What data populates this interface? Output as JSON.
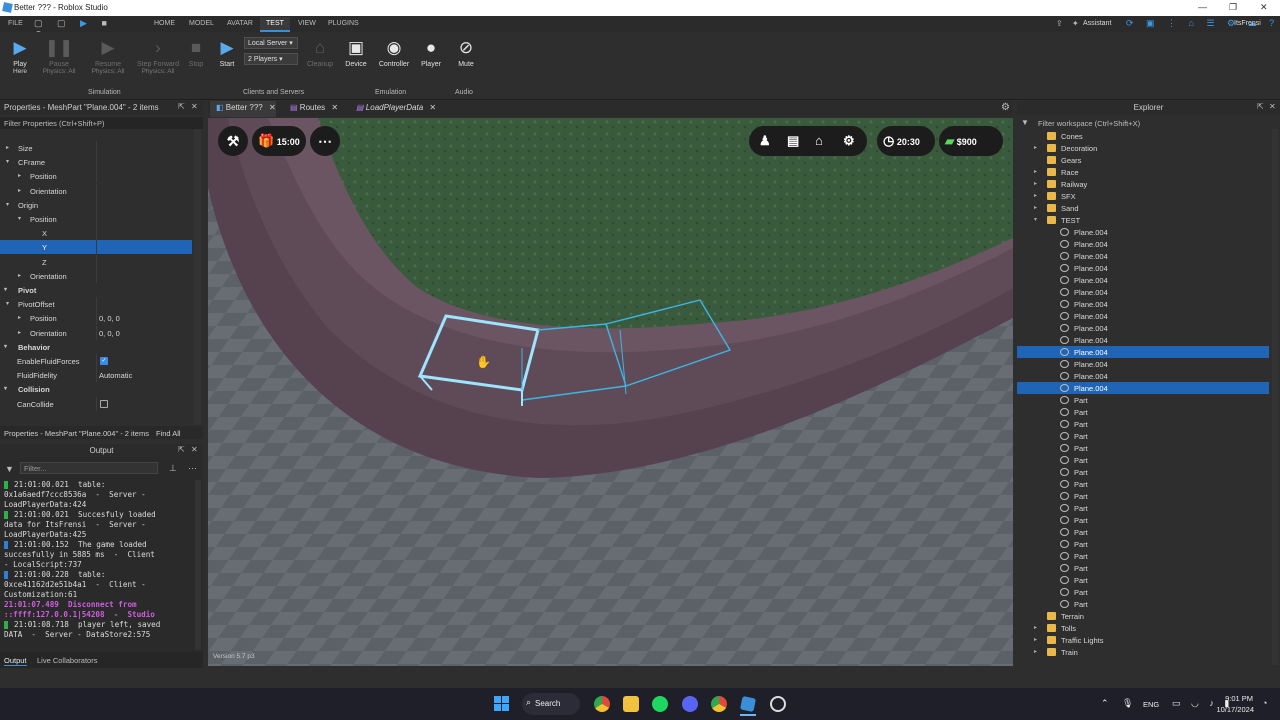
{
  "window": {
    "title": "Better ??? - Roblox Studio"
  },
  "menu": {
    "file": "FILE",
    "tabs": [
      "HOME",
      "MODEL",
      "AVATAR",
      "TEST",
      "VIEW",
      "PLUGINS"
    ],
    "assistant": "Assistant",
    "user": "ItsFrensi"
  },
  "ribbon": {
    "play": "Play",
    "play_sub": "Here",
    "pause": "Pause",
    "pause_sub": "Physics: All",
    "resume": "Resume",
    "resume_sub": "Physics: All",
    "step": "Step Forward",
    "step_sub": "Physics: All",
    "stop": "Stop",
    "start": "Start",
    "server_dd": "Local Server",
    "players_dd": "2 Players",
    "cleanup": "Cleanup",
    "device": "Device",
    "controller": "Controller",
    "player": "Player",
    "mute": "Mute",
    "groups": {
      "simulation": "Simulation",
      "clients": "Clients and Servers",
      "emulation": "Emulation",
      "audio": "Audio"
    }
  },
  "properties": {
    "title": "Properties - MeshPart \"Plane.004\" - 2 items",
    "filter": "Filter Properties (Ctrl+Shift+P)",
    "rows": [
      {
        "name": "Size",
        "indent": 1,
        "arrow": "▸"
      },
      {
        "name": "CFrame",
        "indent": 1,
        "arrow": "▾"
      },
      {
        "name": "Position",
        "indent": 2,
        "arrow": "▸"
      },
      {
        "name": "Orientation",
        "indent": 2,
        "arrow": "▸"
      },
      {
        "name": "Origin",
        "indent": 1,
        "arrow": "▾"
      },
      {
        "name": "Position",
        "indent": 2,
        "arrow": "▾"
      },
      {
        "name": "X",
        "indent": 3
      },
      {
        "name": "Y",
        "indent": 3,
        "sel": true
      },
      {
        "name": "Z",
        "indent": 3
      },
      {
        "name": "Orientation",
        "indent": 2,
        "arrow": "▸"
      },
      {
        "name": "Pivot",
        "indent": 0,
        "arrow": "▾",
        "cat": true
      },
      {
        "name": "PivotOffset",
        "indent": 1,
        "arrow": "▾"
      },
      {
        "name": "Position",
        "indent": 2,
        "arrow": "▸",
        "value": "0, 0, 0"
      },
      {
        "name": "Orientation",
        "indent": 2,
        "arrow": "▸",
        "value": "0, 0, 0"
      },
      {
        "name": "Behavior",
        "indent": 0,
        "arrow": "▾",
        "cat": true
      },
      {
        "name": "EnableFluidForces",
        "indent": 1,
        "check": "on"
      },
      {
        "name": "FluidFidelity",
        "indent": 1,
        "value": "Automatic"
      },
      {
        "name": "Collision",
        "indent": 0,
        "arrow": "▾",
        "cat": true
      },
      {
        "name": "CanCollide",
        "indent": 1,
        "check": "off"
      }
    ],
    "footer": "Properties - MeshPart \"Plane.004\" - 2 items",
    "find_all": "Find All"
  },
  "output": {
    "title": "Output",
    "filter_placeholder": "Filter...",
    "lines": [
      {
        "text": "21:01:00.021  table:",
        "mark": "#2fae4a"
      },
      {
        "text": "0x1a6aedf7ccc8536a  -  Server -"
      },
      {
        "text": "LoadPlayerData:424"
      },
      {
        "text": "21:01:00.021  Succesfuly loaded",
        "mark": "#2fae4a"
      },
      {
        "text": "data for ItsFrensi  -  Server -"
      },
      {
        "text": "LoadPlayerData:425"
      },
      {
        "text": "21:01:00.152  The game loaded",
        "mark": "#2f7fd6"
      },
      {
        "text": "succesfully in 5885 ms  -  Client"
      },
      {
        "text": "- LocalScript:737"
      },
      {
        "text": "21:01:00.228  table:",
        "mark": "#2f7fd6"
      },
      {
        "text": "0xce41162d2e51b4a1  -  Client -"
      },
      {
        "text": "Customization:61"
      },
      {
        "text": "21:01:07.489  Disconnect from",
        "style": "dis"
      },
      {
        "text": "::ffff:127.0.0.1|54208  -  Studio",
        "style": "dis"
      },
      {
        "text": "21:01:08.718  player left, saved",
        "mark": "#2fae4a"
      },
      {
        "text": "DATA  -  Server - DataStore2:575"
      }
    ],
    "tabs": [
      "Output",
      "Live Collaborators"
    ]
  },
  "doc_tabs": [
    "Better ???",
    "Routes",
    "LoadPlayerData"
  ],
  "hud": {
    "timer1": "15:00",
    "timer2": "20:30",
    "money": "$900",
    "version": "Version 5.7 p3"
  },
  "explorer": {
    "title": "Explorer",
    "filter": "Filter workspace (Ctrl+Shift+X)",
    "items": [
      {
        "n": "Cones",
        "t": "folder",
        "i": 1
      },
      {
        "n": "Decoration",
        "t": "folder",
        "i": 1,
        "a": "▸"
      },
      {
        "n": "Gears",
        "t": "folder",
        "i": 1
      },
      {
        "n": "Race",
        "t": "folder",
        "i": 1,
        "a": "▸"
      },
      {
        "n": "Railway",
        "t": "folder",
        "i": 1,
        "a": "▸"
      },
      {
        "n": "SFX",
        "t": "folder",
        "i": 1,
        "a": "▸"
      },
      {
        "n": "Sand",
        "t": "folder",
        "i": 1,
        "a": "▸"
      },
      {
        "n": "TEST",
        "t": "folder",
        "i": 1,
        "a": "▾"
      },
      {
        "n": "Plane.004",
        "t": "mesh",
        "i": 2
      },
      {
        "n": "Plane.004",
        "t": "mesh",
        "i": 2
      },
      {
        "n": "Plane.004",
        "t": "mesh",
        "i": 2
      },
      {
        "n": "Plane.004",
        "t": "mesh",
        "i": 2
      },
      {
        "n": "Plane.004",
        "t": "mesh",
        "i": 2
      },
      {
        "n": "Plane.004",
        "t": "mesh",
        "i": 2
      },
      {
        "n": "Plane.004",
        "t": "mesh",
        "i": 2
      },
      {
        "n": "Plane.004",
        "t": "mesh",
        "i": 2
      },
      {
        "n": "Plane.004",
        "t": "mesh",
        "i": 2
      },
      {
        "n": "Plane.004",
        "t": "mesh",
        "i": 2
      },
      {
        "n": "Plane.004",
        "t": "mesh",
        "i": 2,
        "sel": true
      },
      {
        "n": "Plane.004",
        "t": "mesh",
        "i": 2
      },
      {
        "n": "Plane.004",
        "t": "mesh",
        "i": 2
      },
      {
        "n": "Plane.004",
        "t": "mesh",
        "i": 2,
        "sel": true
      },
      {
        "n": "Part",
        "t": "mesh",
        "i": 2
      },
      {
        "n": "Part",
        "t": "mesh",
        "i": 2
      },
      {
        "n": "Part",
        "t": "mesh",
        "i": 2
      },
      {
        "n": "Part",
        "t": "mesh",
        "i": 2
      },
      {
        "n": "Part",
        "t": "mesh",
        "i": 2
      },
      {
        "n": "Part",
        "t": "mesh",
        "i": 2
      },
      {
        "n": "Part",
        "t": "mesh",
        "i": 2
      },
      {
        "n": "Part",
        "t": "mesh",
        "i": 2
      },
      {
        "n": "Part",
        "t": "mesh",
        "i": 2
      },
      {
        "n": "Part",
        "t": "mesh",
        "i": 2
      },
      {
        "n": "Part",
        "t": "mesh",
        "i": 2
      },
      {
        "n": "Part",
        "t": "mesh",
        "i": 2
      },
      {
        "n": "Part",
        "t": "mesh",
        "i": 2
      },
      {
        "n": "Part",
        "t": "mesh",
        "i": 2
      },
      {
        "n": "Part",
        "t": "mesh",
        "i": 2
      },
      {
        "n": "Part",
        "t": "mesh",
        "i": 2
      },
      {
        "n": "Part",
        "t": "mesh",
        "i": 2
      },
      {
        "n": "Part",
        "t": "mesh",
        "i": 2
      },
      {
        "n": "Terrain",
        "t": "folder",
        "i": 1
      },
      {
        "n": "Tolls",
        "t": "folder",
        "i": 1,
        "a": "▸"
      },
      {
        "n": "Traffic Lights",
        "t": "folder",
        "i": 1,
        "a": "▸"
      },
      {
        "n": "Train",
        "t": "folder",
        "i": 1,
        "a": "▸"
      }
    ]
  },
  "taskbar": {
    "search": "Search",
    "lang": "ENG",
    "time": "9:01 PM",
    "date": "10/17/2024"
  }
}
